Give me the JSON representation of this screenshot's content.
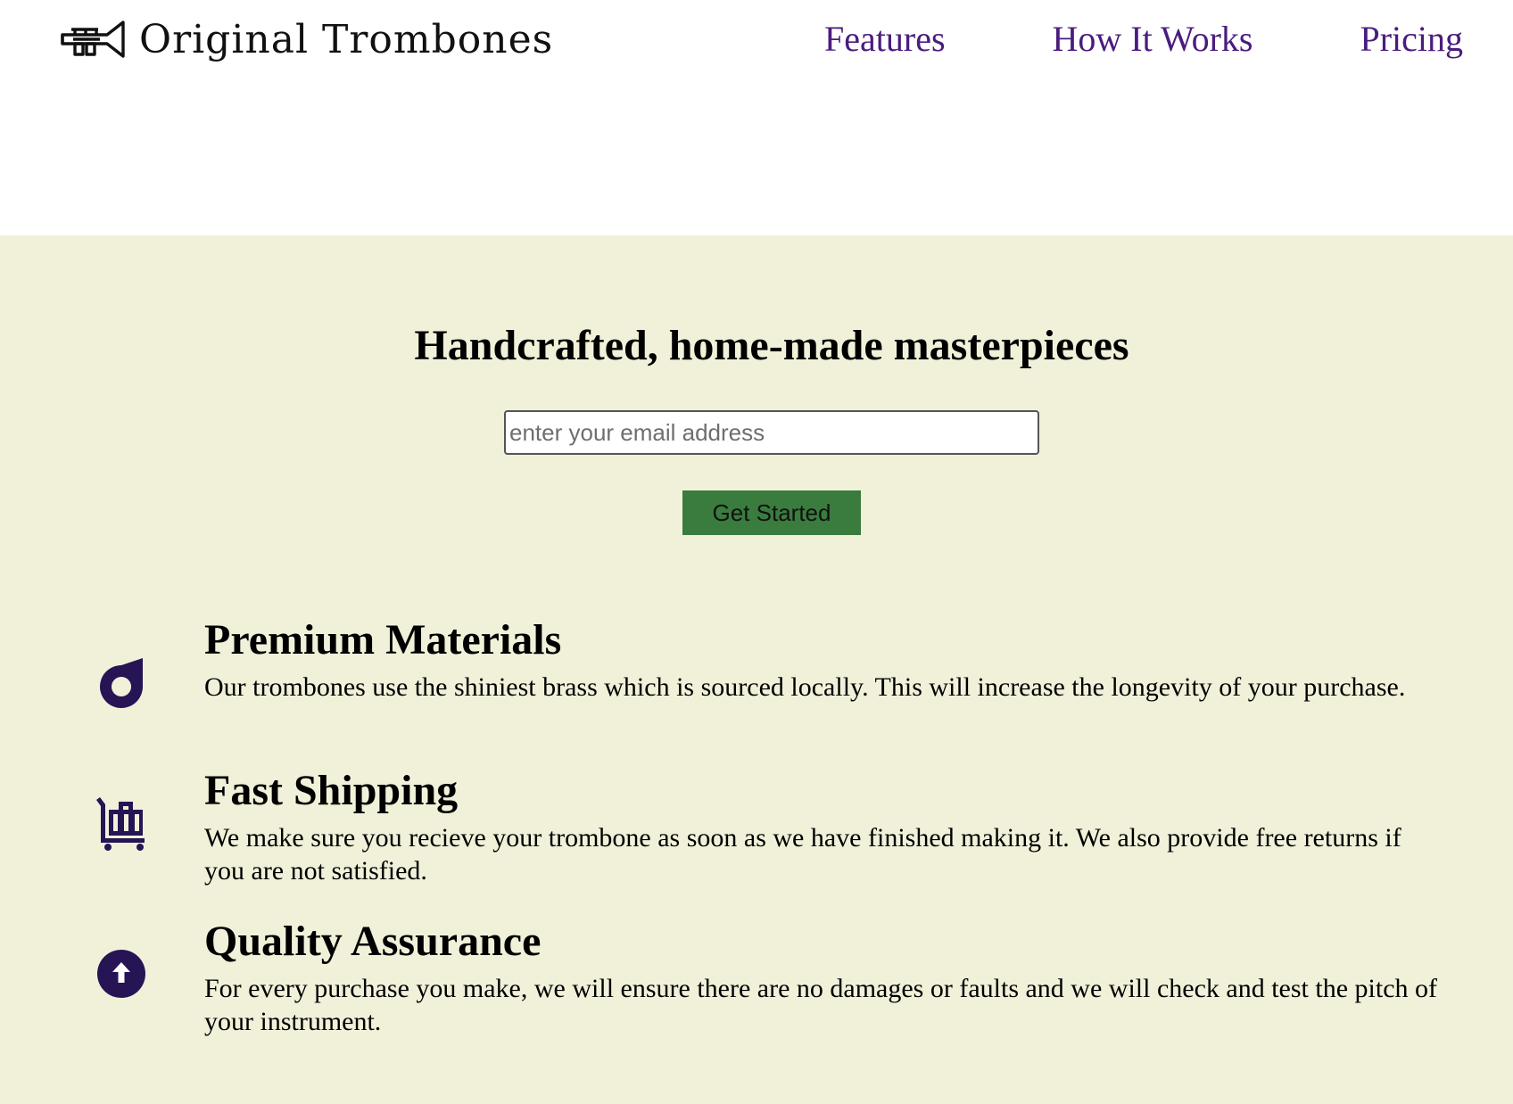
{
  "header": {
    "brand": "Original Trombones",
    "logo_icon": "trombone-logo-icon",
    "nav": [
      {
        "label": "Features"
      },
      {
        "label": "How It Works"
      },
      {
        "label": "Pricing"
      }
    ]
  },
  "hero": {
    "title": "Handcrafted, home-made masterpieces",
    "email_placeholder": "enter your email address",
    "cta_label": "Get Started"
  },
  "features": [
    {
      "icon": "drop-icon",
      "title": "Premium Materials",
      "description": "Our trombones use the shiniest brass which is sourced locally. This will increase the longevity of your purchase."
    },
    {
      "icon": "luggage-cart-icon",
      "title": "Fast Shipping",
      "description": "We make sure you recieve your trombone as soon as we have finished making it. We also provide free returns if you are not satisfied."
    },
    {
      "icon": "arrow-circle-up-icon",
      "title": "Quality Assurance",
      "description": "For every purchase you make, we will ensure there are no damages or faults and we will check and test the pitch of your instrument."
    }
  ],
  "colors": {
    "header_bg": "#ffffff",
    "page_bg": "#f1f1da",
    "nav_link": "#4a1c7f",
    "cta_bg": "#3a7c3e",
    "icon": "#261454"
  }
}
